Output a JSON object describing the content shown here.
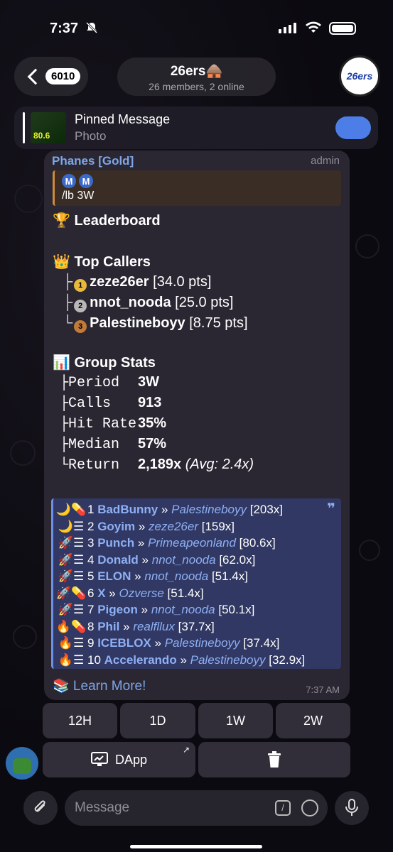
{
  "status": {
    "time": "7:37",
    "mute_icon": "bell-slash-icon"
  },
  "header": {
    "back_count": "6010",
    "title": "26ers🛖",
    "subtitle": "26 members, 2 online",
    "avatar_text": "26ers"
  },
  "pinned": {
    "title": "Pinned Message",
    "subtitle": "Photo",
    "thumb_text": "80.6"
  },
  "message": {
    "sender": "Phanes [Gold]",
    "role": "admin",
    "reply_badges": [
      "M",
      "M"
    ],
    "reply_text": "/lb 3W",
    "leaderboard": "🏆 Leaderboard",
    "top_callers_title": "👑 Top Callers",
    "callers": [
      {
        "prefix": "├",
        "medal": "1",
        "name": "zeze26er",
        "pts": "[34.0 pts]"
      },
      {
        "prefix": "├",
        "medal": "2",
        "name": "nnot_nooda",
        "pts": "[25.0 pts]"
      },
      {
        "prefix": "└",
        "medal": "3",
        "name": "Palestineboyy",
        "pts": "[8.75 pts]"
      }
    ],
    "group_stats_title": "📊 Group Stats",
    "stats": [
      {
        "prefix": "├",
        "key": "Period",
        "value": "3W",
        "extra": ""
      },
      {
        "prefix": "├",
        "key": "Calls",
        "value": "913",
        "extra": ""
      },
      {
        "prefix": "├",
        "key": "Hit Rate",
        "value": "35%",
        "extra": ""
      },
      {
        "prefix": "├",
        "key": "Median",
        "value": "57%",
        "extra": ""
      },
      {
        "prefix": "└",
        "key": "Return",
        "value": "2,189x",
        "extra": "(Avg: 2.4x)"
      }
    ],
    "calls": [
      {
        "icons": "🌙💊",
        "rank": "1",
        "name": "BadBunny",
        "sep": "»",
        "user": "Palestineboyy",
        "mult": "[203x]"
      },
      {
        "icons": "🌙☰",
        "rank": "2",
        "name": "Goyim",
        "sep": "»",
        "user": "zeze26er",
        "mult": "[159x]"
      },
      {
        "icons": "🚀☰",
        "rank": "3",
        "name": "Punch",
        "sep": "»",
        "user": "Primeapeonland",
        "mult": "[80.6x]"
      },
      {
        "icons": "🚀☰",
        "rank": "4",
        "name": "Donald",
        "sep": "»",
        "user": "nnot_nooda",
        "mult": "[62.0x]"
      },
      {
        "icons": "🚀☰",
        "rank": "5",
        "name": "ELON",
        "sep": "»",
        "user": "nnot_nooda",
        "mult": "[51.4x]"
      },
      {
        "icons": "🚀💊",
        "rank": "6",
        "name": "X",
        "sep": "»",
        "user": "Ozverse",
        "mult": "[51.4x]"
      },
      {
        "icons": "🚀☰",
        "rank": "7",
        "name": "Pigeon",
        "sep": "»",
        "user": "nnot_nooda",
        "mult": "[50.1x]"
      },
      {
        "icons": "🔥💊",
        "rank": "8",
        "name": "Phil",
        "sep": "»",
        "user": "realfllux",
        "mult": "[37.7x]"
      },
      {
        "icons": "🔥☰",
        "rank": "9",
        "name": "ICEBLOX",
        "sep": "»",
        "user": "Palestineboyy",
        "mult": "[37.4x]"
      },
      {
        "icons": "🔥☰",
        "rank": "10",
        "name": "Accelerando",
        "sep": "»",
        "user": "Palestineboyy",
        "mult": "[32.9x]"
      }
    ],
    "learn_more": "📚 Learn More!",
    "time": "7:37 AM"
  },
  "keyboard": {
    "row1": [
      "12H",
      "1D",
      "1W",
      "2W"
    ],
    "dapp_label": "DApp",
    "delete_icon": "trash-icon"
  },
  "composer": {
    "placeholder": "Message"
  },
  "colors": {
    "accent": "#4d7ee8",
    "link": "#7fa6e6",
    "bubble": "#2a2632"
  }
}
